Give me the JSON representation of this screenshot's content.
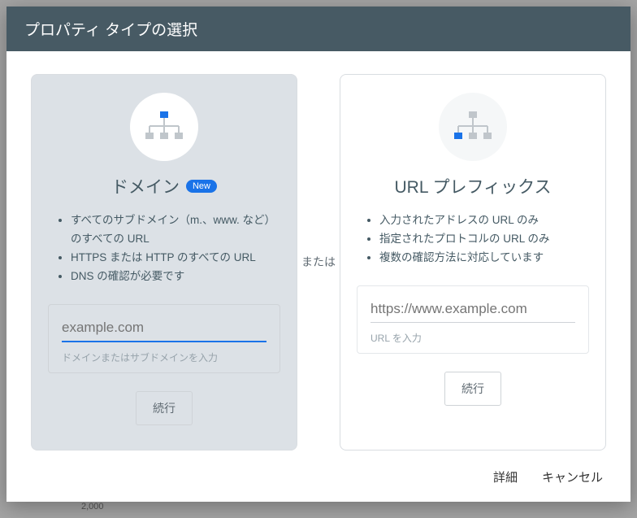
{
  "dialog": {
    "title": "プロパティ タイプの選択",
    "divider_label": "または"
  },
  "domain_card": {
    "title": "ドメイン",
    "new_badge": "New",
    "bullets": [
      "すべてのサブドメイン（m.、www. など）のすべての URL",
      "HTTPS または HTTP のすべての URL",
      "DNS の確認が必要です"
    ],
    "placeholder": "example.com",
    "hint": "ドメインまたはサブドメインを入力",
    "continue": "続行"
  },
  "url_card": {
    "title": "URL プレフィックス",
    "bullets": [
      "入力されたアドレスの URL のみ",
      "指定されたプロトコルの URL のみ",
      "複数の確認方法に対応しています"
    ],
    "placeholder": "https://www.example.com",
    "hint": "URL を入力",
    "continue": "続行"
  },
  "footer": {
    "details": "詳細",
    "cancel": "キャンセル"
  },
  "stray": "2,000"
}
